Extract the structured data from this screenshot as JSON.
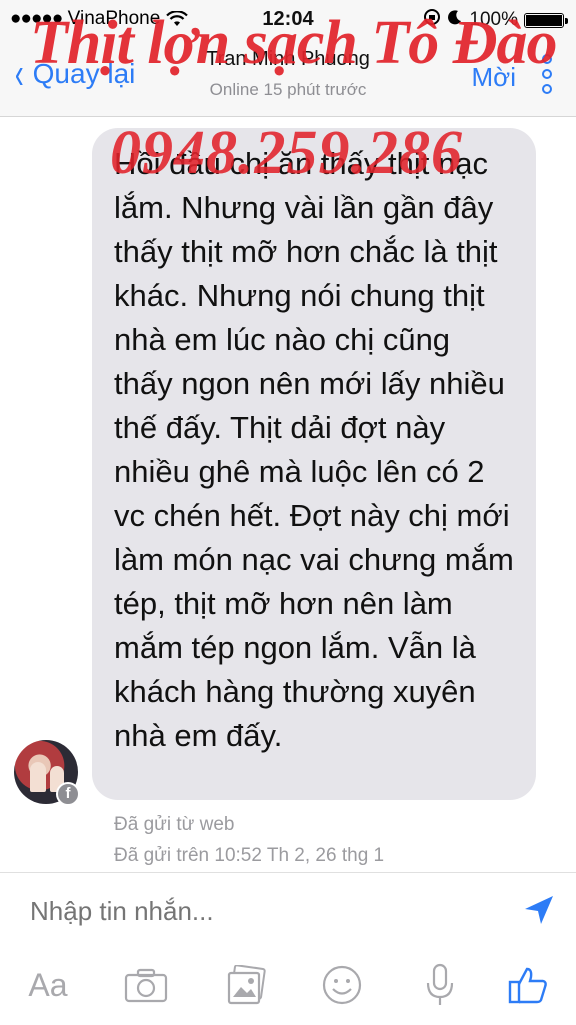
{
  "status_bar": {
    "signal_dots": "●●●●●",
    "carrier": "VinaPhone",
    "time": "12:04",
    "battery": "100%"
  },
  "nav": {
    "back_label": "Quay lại",
    "contact_name": "Tran Minh Phuong",
    "online_status": "Online 15 phút trước",
    "more_label": "Mời"
  },
  "watermark": {
    "title": "Thịt lợn sạch Tô Đào",
    "phone": "0948.259.286"
  },
  "message": {
    "text": "Hồi đầu chị ăn thấy thịt nạc lắm. Nhưng vài lần gần đây thấy thịt mỡ hơn chắc là thịt khác. Nhưng nói chung thịt nhà em lúc nào chị cũng thấy ngon nên mới lấy nhiều thế đấy. Thịt dải đợt này nhiều ghê mà luộc lên có 2 vc chén hết. Đợt này chị mới làm món nạc vai chưng mắm tép, thịt mỡ hơn nên làm mắm tép ngon lắm. Vẫn là khách hàng thường xuyên nhà em đấy.",
    "sent_from": "Đã gửi từ web",
    "sent_on": "Đã gửi trên 10:52 Th 2, 26 thg 1"
  },
  "composer": {
    "placeholder": "Nhập tin nhắn...",
    "aa_label": "Aa"
  },
  "colors": {
    "accent": "#2d7cf6",
    "bubble": "#e6e5ea",
    "watermark": "#e2232b"
  }
}
